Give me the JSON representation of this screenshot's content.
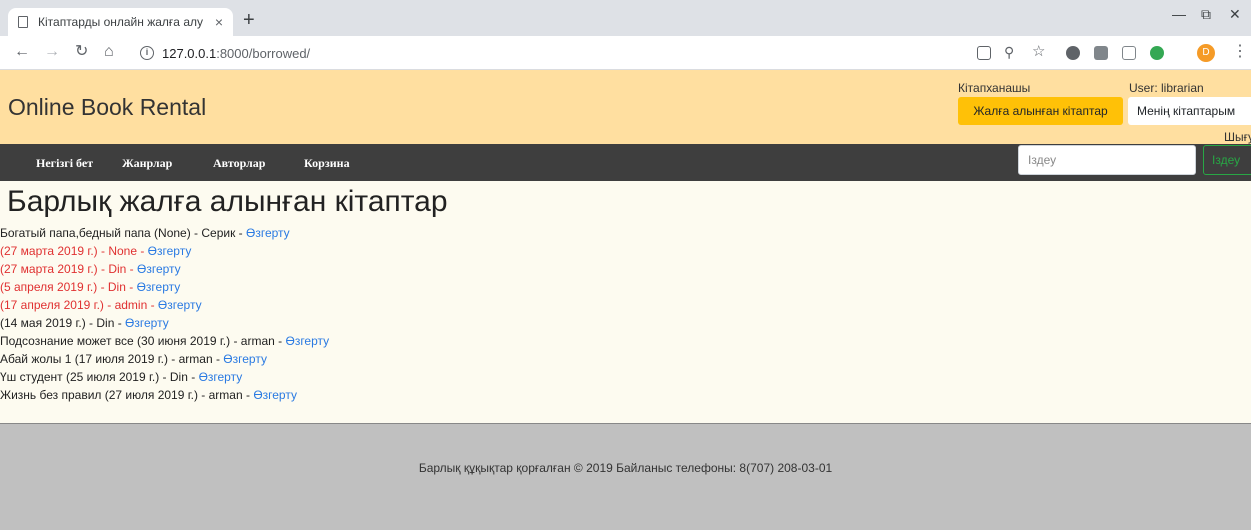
{
  "browser": {
    "tab_title": "Кітаптарды онлайн жалға алу",
    "tab_close": "×",
    "new_tab": "+",
    "url_host": "127.0.0.1",
    "url_path": ":8000/borrowed/",
    "profile_initial": "D",
    "icons": [
      "back-icon",
      "forward-icon",
      "reload-icon",
      "home-icon",
      "info-icon",
      "translate-icon",
      "zoom-icon",
      "star-icon",
      "menu-icon"
    ]
  },
  "header": {
    "brand": "Online Book Rental",
    "role": "Кітапханашы",
    "user": "User: librarian",
    "borrowed_button": "Жалға алынған кітаптар",
    "my_books_button": "Менің кітаптарым",
    "logout": "Шығу",
    "colors": {
      "header_bg": "#ffdfa0",
      "active_button": "#ffc107"
    }
  },
  "nav": {
    "items": [
      "Негізгі бет",
      "Жанрлар",
      "Авторлар",
      "Корзина"
    ],
    "search_placeholder": "Іздеу",
    "search_button": "Іздеу"
  },
  "main": {
    "title": "Барлық жалға алынған кітаптар",
    "edit_label": "Өзгерту",
    "entries": [
      {
        "text": "Богатый папа,бедный папа (None) - Серик - ",
        "overdue": false
      },
      {
        "text": "(27 марта 2019 г.) - None - ",
        "overdue": true
      },
      {
        "text": "(27 марта 2019 г.) - Din - ",
        "overdue": true
      },
      {
        "text": "(5 апреля 2019 г.) - Din - ",
        "overdue": true
      },
      {
        "text": "(17 апреля 2019 г.) - admin - ",
        "overdue": true
      },
      {
        "text": "(14 мая 2019 г.) - Din - ",
        "overdue": false
      },
      {
        "text": "Подсознание может все (30 июня 2019 г.) - arman - ",
        "overdue": false
      },
      {
        "text": "Абай жолы 1 (17 июля 2019 г.) - arman - ",
        "overdue": false
      },
      {
        "text": "Үш студент (25 июля 2019 г.) - Din - ",
        "overdue": false
      },
      {
        "text": "Жизнь без правил (27 июля 2019 г.) - arman - ",
        "overdue": false
      }
    ]
  },
  "footer": {
    "text": "Барлық құқықтар қорғалған © 2019 Байланыс телефоны: 8(707) 208-03-01"
  }
}
